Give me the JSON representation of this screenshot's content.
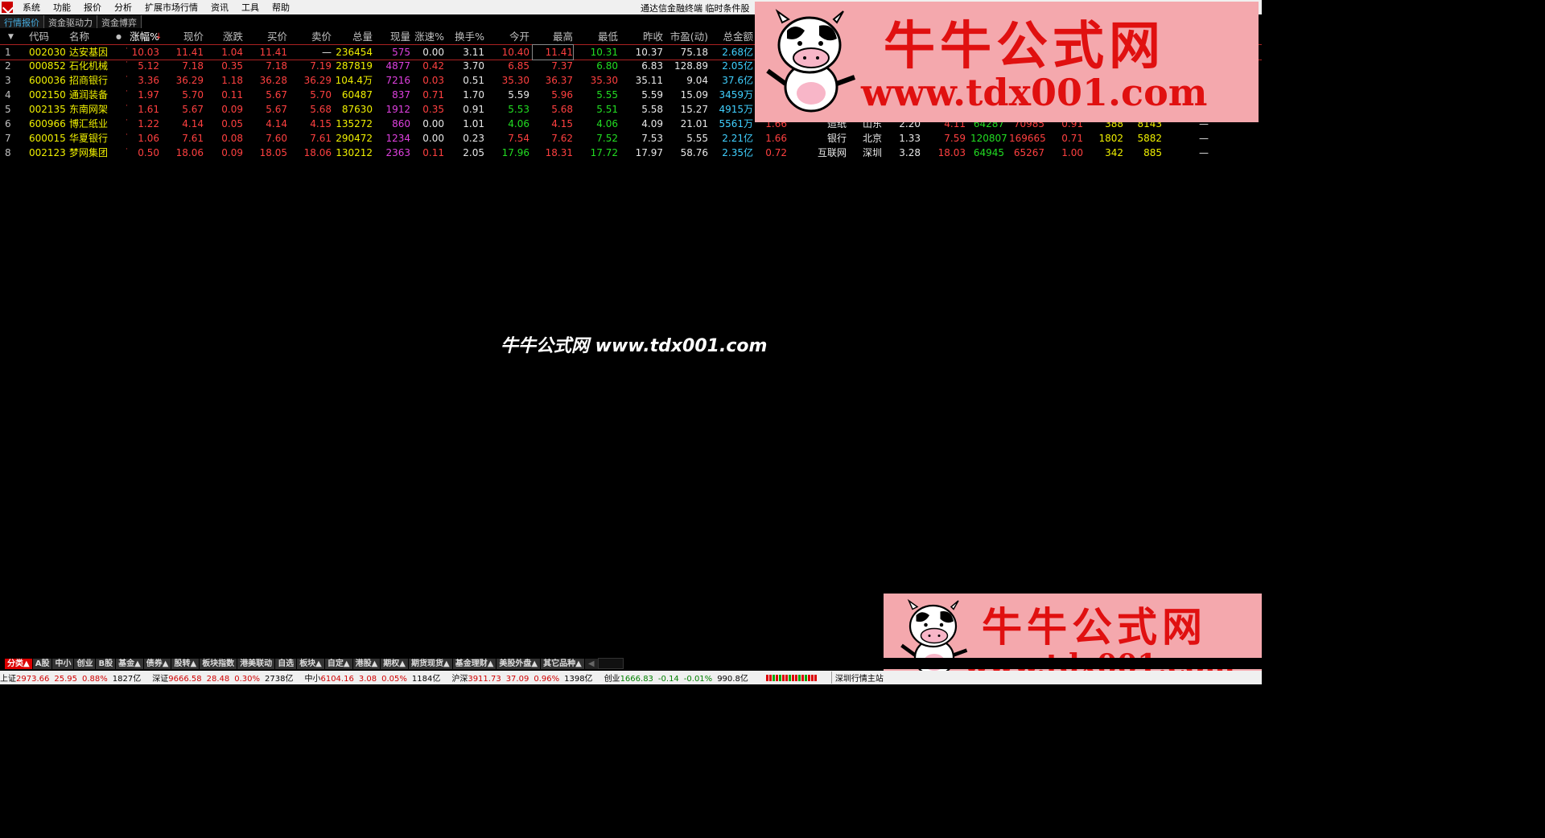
{
  "menu": {
    "items": [
      "系统",
      "功能",
      "报价",
      "分析",
      "扩展市场行情",
      "资讯",
      "工具",
      "帮助"
    ],
    "title": "通达信金融终端 临时条件股"
  },
  "tabs": [
    {
      "label": "行情报价",
      "active": true
    },
    {
      "label": "资金驱动力",
      "active": false
    },
    {
      "label": "资金博弈",
      "active": false
    }
  ],
  "table": {
    "headers": [
      "代码",
      "名称",
      "涨幅%",
      "现价",
      "涨跌",
      "买价",
      "卖价",
      "总量",
      "现量",
      "涨速%",
      "换手%",
      "今开",
      "最高",
      "最低",
      "昨收",
      "市盈(动)",
      "总金额"
    ],
    "rows": [
      {
        "idx": "1",
        "code": "002030",
        "name": "达安基因",
        "chg_pct": "10.03",
        "price": "11.41",
        "chg": "1.04",
        "bid": "11.41",
        "ask": "—",
        "vol": "236454",
        "cur_vol": "575",
        "speed": "0.00",
        "turnover": "3.11",
        "open": "10.40",
        "high": "11.41",
        "low": "10.31",
        "prev": "10.37",
        "pe": "75.18",
        "amount": "2.68亿",
        "x1": "",
        "ind": "",
        "area": "",
        "x2": "",
        "x3": "",
        "x4": "",
        "x5": "",
        "x6": "",
        "x7": "",
        "x8": "",
        "x9": ""
      },
      {
        "idx": "2",
        "code": "000852",
        "name": "石化机械",
        "chg_pct": "5.12",
        "price": "7.18",
        "chg": "0.35",
        "bid": "7.18",
        "ask": "7.19",
        "vol": "287819",
        "cur_vol": "4877",
        "speed": "0.42",
        "turnover": "3.70",
        "open": "6.85",
        "high": "7.37",
        "low": "6.80",
        "prev": "6.83",
        "pe": "128.89",
        "amount": "2.05亿",
        "x1": "",
        "ind": "",
        "area": "",
        "x2": "",
        "x3": "",
        "x4": "",
        "x5": "",
        "x6": "",
        "x7": "",
        "x8": "",
        "x9": ""
      },
      {
        "idx": "3",
        "code": "600036",
        "name": "招商银行",
        "chg_pct": "3.36",
        "price": "36.29",
        "chg": "1.18",
        "bid": "36.28",
        "ask": "36.29",
        "vol": "104.4万",
        "cur_vol": "7216",
        "speed": "0.03",
        "turnover": "0.51",
        "open": "35.30",
        "high": "36.37",
        "low": "35.30",
        "prev": "35.11",
        "pe": "9.04",
        "amount": "37.6亿",
        "x1": "",
        "ind": "",
        "area": "",
        "x2": "",
        "x3": "",
        "x4": "",
        "x5": "",
        "x6": "",
        "x7": "",
        "x8": "",
        "x9": ""
      },
      {
        "idx": "4",
        "code": "002150",
        "name": "通润装备",
        "chg_pct": "1.97",
        "price": "5.70",
        "chg": "0.11",
        "bid": "5.67",
        "ask": "5.70",
        "vol": "60487",
        "cur_vol": "837",
        "speed": "0.71",
        "turnover": "1.70",
        "open": "5.59",
        "high": "5.96",
        "low": "5.55",
        "prev": "5.59",
        "pe": "15.09",
        "amount": "3459万",
        "x1": "",
        "ind": "",
        "area": "",
        "x2": "",
        "x3": "",
        "x4": "",
        "x5": "",
        "x6": "",
        "x7": "",
        "x8": "",
        "x9": ""
      },
      {
        "idx": "5",
        "code": "002135",
        "name": "东南网架",
        "chg_pct": "1.61",
        "price": "5.67",
        "chg": "0.09",
        "bid": "5.67",
        "ask": "5.68",
        "vol": "87630",
        "cur_vol": "1912",
        "speed": "0.35",
        "turnover": "0.91",
        "open": "5.53",
        "high": "5.68",
        "low": "5.51",
        "prev": "5.58",
        "pe": "15.27",
        "amount": "4915万",
        "x1": "",
        "ind": "",
        "area": "",
        "x2": "",
        "x3": "",
        "x4": "",
        "x5": "",
        "x6": "",
        "x7": "",
        "x8": "",
        "x9": ""
      },
      {
        "idx": "6",
        "code": "600966",
        "name": "博汇纸业",
        "chg_pct": "1.22",
        "price": "4.14",
        "chg": "0.05",
        "bid": "4.14",
        "ask": "4.15",
        "vol": "135272",
        "cur_vol": "860",
        "speed": "0.00",
        "turnover": "1.01",
        "open": "4.06",
        "high": "4.15",
        "low": "4.06",
        "prev": "4.09",
        "pe": "21.01",
        "amount": "5561万",
        "x1": "1.66",
        "ind": "造纸",
        "area": "山东",
        "x2": "2.20",
        "x3": "4.11",
        "x4": "64287",
        "x5": "70985",
        "x6": "0.91",
        "x7": "388",
        "x8": "8143",
        "x9": "—"
      },
      {
        "idx": "7",
        "code": "600015",
        "name": "华夏银行",
        "chg_pct": "1.06",
        "price": "7.61",
        "chg": "0.08",
        "bid": "7.60",
        "ask": "7.61",
        "vol": "290472",
        "cur_vol": "1234",
        "speed": "0.00",
        "turnover": "0.23",
        "open": "7.54",
        "high": "7.62",
        "low": "7.52",
        "prev": "7.53",
        "pe": "5.55",
        "amount": "2.21亿",
        "x1": "1.66",
        "ind": "银行",
        "area": "北京",
        "x2": "1.33",
        "x3": "7.59",
        "x4": "120807",
        "x5": "169665",
        "x6": "0.71",
        "x7": "1802",
        "x8": "5882",
        "x9": "—"
      },
      {
        "idx": "8",
        "code": "002123",
        "name": "梦网集团",
        "chg_pct": "0.50",
        "price": "18.06",
        "chg": "0.09",
        "bid": "18.05",
        "ask": "18.06",
        "vol": "130212",
        "cur_vol": "2363",
        "speed": "0.11",
        "turnover": "2.05",
        "open": "17.96",
        "high": "18.31",
        "low": "17.72",
        "prev": "17.97",
        "pe": "58.76",
        "amount": "2.35亿",
        "x1": "0.72",
        "ind": "互联网",
        "area": "深圳",
        "x2": "3.28",
        "x3": "18.03",
        "x4": "64945",
        "x5": "65267",
        "x6": "1.00",
        "x7": "342",
        "x8": "885",
        "x9": "—"
      }
    ]
  },
  "watermark": {
    "brand": "牛牛公式网",
    "url": "www.tdx001.com",
    "center": "牛牛公式网 www.tdx001.com"
  },
  "categories": [
    {
      "label": "分类▲",
      "active": true
    },
    {
      "label": "A股"
    },
    {
      "label": "中小"
    },
    {
      "label": "创业"
    },
    {
      "label": "B股"
    },
    {
      "label": "基金▲"
    },
    {
      "label": "债券▲"
    },
    {
      "label": "股转▲"
    },
    {
      "label": "板块指数"
    },
    {
      "label": "港美联动"
    },
    {
      "label": "自选"
    },
    {
      "label": "板块▲"
    },
    {
      "label": "自定▲"
    },
    {
      "label": "港股▲"
    },
    {
      "label": "期权▲"
    },
    {
      "label": "期货现货▲"
    },
    {
      "label": "基金理财▲"
    },
    {
      "label": "美股外盘▲"
    },
    {
      "label": "其它品种▲"
    }
  ],
  "status": {
    "items": [
      {
        "name": "上证",
        "value": "2973.66",
        "chg": "25.95",
        "pct": "0.88%",
        "amt": "1827亿"
      },
      {
        "name": "深证",
        "value": "9666.58",
        "chg": "28.48",
        "pct": "0.30%",
        "amt": "2738亿"
      },
      {
        "name": "中小",
        "value": "6104.16",
        "chg": "3.08",
        "pct": "0.05%",
        "amt": "1184亿"
      },
      {
        "name": "沪深",
        "value": "3911.73",
        "chg": "37.09",
        "pct": "0.96%",
        "amt": "1398亿"
      },
      {
        "name": "创业",
        "value": "1666.83",
        "chg": "-0.14",
        "pct": "-0.01%",
        "amt": "990.8亿"
      }
    ],
    "server": "深圳行情主站"
  },
  "colors": {
    "up": "#ff4040",
    "down": "#22dd22",
    "flat": "#e8e8e8",
    "code": "#f0f000",
    "volume": "#e040e0",
    "amount": "#40d0ff",
    "watermark_bg": "#f4a8ad",
    "watermark_text": "#e01010"
  }
}
